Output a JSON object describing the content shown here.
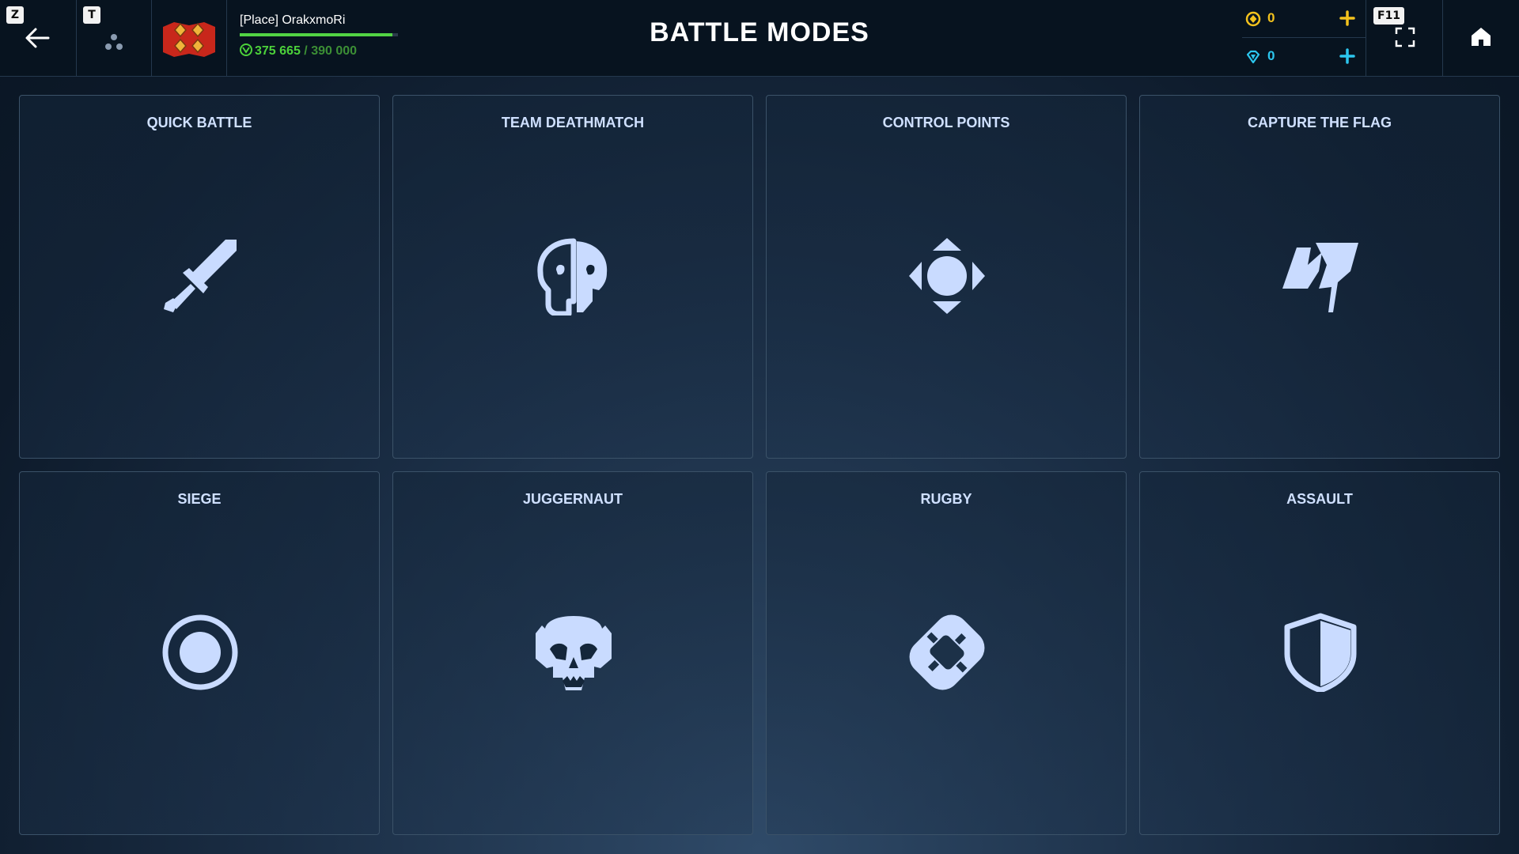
{
  "header": {
    "back_hotkey": "Z",
    "squad_hotkey": "T",
    "title": "BATTLE MODES",
    "fullscreen_hotkey": "F11"
  },
  "player": {
    "name": "[Place] OrakxmoRi",
    "xp_current": "375 665",
    "xp_separator": " / ",
    "xp_max": "390 000",
    "xp_progress": 0.9632
  },
  "currency": {
    "gold": "0",
    "gems": "0"
  },
  "modes": [
    {
      "label": "QUICK BATTLE",
      "icon": "sword-icon"
    },
    {
      "label": "TEAM DEATHMATCH",
      "icon": "half-skull-icon"
    },
    {
      "label": "CONTROL POINTS",
      "icon": "control-point-icon"
    },
    {
      "label": "CAPTURE THE FLAG",
      "icon": "flag-icon"
    },
    {
      "label": "SIEGE",
      "icon": "target-circle-icon"
    },
    {
      "label": "JUGGERNAUT",
      "icon": "skull-icon"
    },
    {
      "label": "RUGBY",
      "icon": "ball-icon"
    },
    {
      "label": "ASSAULT",
      "icon": "shield-icon"
    }
  ],
  "colors": {
    "accent_icon": "#c9dbff",
    "xp_green": "#4cd13a",
    "gold": "#f3c21d",
    "gem": "#2cc6ee"
  }
}
